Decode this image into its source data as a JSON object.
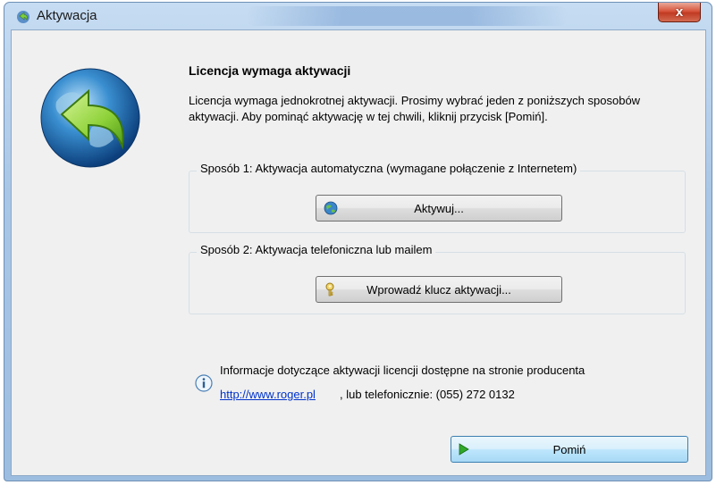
{
  "window": {
    "title": "Aktywacja",
    "close_label": "x"
  },
  "content": {
    "heading": "Licencja wymaga aktywacji",
    "description": "Licencja wymaga jednokrotnej aktywacji. Prosimy wybrać jeden z poniższych sposobów aktywacji. Aby pominąć aktywację w tej chwili, kliknij przycisk [Pomiń]."
  },
  "method1": {
    "legend": "Sposób 1: Aktywacja automatyczna (wymagane połączenie z Internetem)",
    "button_label": "Aktywuj...",
    "button_icon": "globe-icon"
  },
  "method2": {
    "legend": "Sposób 2: Aktywacja telefoniczna lub mailem",
    "button_label": "Wprowadź klucz aktywacji...",
    "button_icon": "key-icon"
  },
  "info": {
    "text": "Informacje dotyczące aktywacji licencji dostępne na stronie producenta",
    "link": "http://www.roger.pl",
    "phone_text": ", lub telefonicznie: (055) 272 0132"
  },
  "skip": {
    "label": "Pomiń",
    "icon": "play-arrow-icon"
  },
  "colors": {
    "link": "#0033cc",
    "close_button": "#c13a22",
    "dialog_background": "#f0f0f0"
  }
}
